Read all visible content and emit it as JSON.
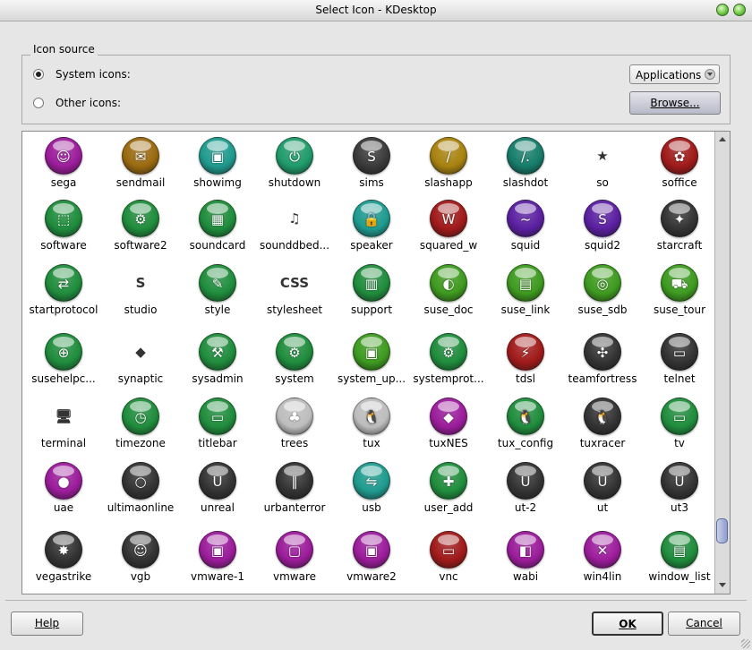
{
  "window": {
    "title": "Select Icon - KDesktop"
  },
  "icon_source": {
    "group_title": "Icon source",
    "system_icons_label": "System icons:",
    "other_icons_label": "Other icons:",
    "selected": "system",
    "category_select": "Applications",
    "browse_label": "Browse..."
  },
  "icons": [
    {
      "label": "sega",
      "color": "#9b1c9b",
      "glyph": "☺"
    },
    {
      "label": "sendmail",
      "color": "#9a6a10",
      "glyph": "✉"
    },
    {
      "label": "showimg",
      "color": "#1f9a8e",
      "glyph": "▣"
    },
    {
      "label": "shutdown",
      "color": "#1f9a6a",
      "glyph": "⏻"
    },
    {
      "label": "sims",
      "color": "#3a3a3a",
      "glyph": "S"
    },
    {
      "label": "slashapp",
      "color": "#a8820f",
      "glyph": "/"
    },
    {
      "label": "slashdot",
      "color": "#167c6a",
      "glyph": "/."
    },
    {
      "label": "so",
      "color": "none",
      "glyph": "★"
    },
    {
      "label": "soffice",
      "color": "#a01a1a",
      "glyph": "✿"
    },
    {
      "label": "software",
      "color": "#1f8c3c",
      "glyph": "⬚"
    },
    {
      "label": "software2",
      "color": "#1f8c3c",
      "glyph": "⚙"
    },
    {
      "label": "soundcard",
      "color": "#1f8c3c",
      "glyph": "▦"
    },
    {
      "label": "sounddbed...",
      "color": "none",
      "glyph": "♫"
    },
    {
      "label": "speaker",
      "color": "#1f9a8e",
      "glyph": "🔒"
    },
    {
      "label": "squared_w",
      "color": "#a01a1a",
      "glyph": "W"
    },
    {
      "label": "squid",
      "color": "#5a1fa0",
      "glyph": "~"
    },
    {
      "label": "squid2",
      "color": "#5a1fa0",
      "glyph": "S"
    },
    {
      "label": "starcraft",
      "color": "#333333",
      "glyph": "✦"
    },
    {
      "label": "startprotocol",
      "color": "#1f8c3c",
      "glyph": "⇄"
    },
    {
      "label": "studio",
      "color": "none",
      "glyph": "S"
    },
    {
      "label": "style",
      "color": "#1f8c3c",
      "glyph": "✎"
    },
    {
      "label": "stylesheet",
      "color": "none",
      "glyph": "CSS"
    },
    {
      "label": "support",
      "color": "#1f8c3c",
      "glyph": "▥"
    },
    {
      "label": "suse_doc",
      "color": "#3d9a1f",
      "glyph": "◐"
    },
    {
      "label": "suse_link",
      "color": "#3d9a1f",
      "glyph": "▤"
    },
    {
      "label": "suse_sdb",
      "color": "#3d9a1f",
      "glyph": "◎"
    },
    {
      "label": "suse_tour",
      "color": "#3d9a1f",
      "glyph": "⛟"
    },
    {
      "label": "susehelpc...",
      "color": "#1f8c3c",
      "glyph": "⊕"
    },
    {
      "label": "synaptic",
      "color": "none",
      "glyph": "◆"
    },
    {
      "label": "sysadmin",
      "color": "#1f8c3c",
      "glyph": "⚒"
    },
    {
      "label": "system",
      "color": "#1f8c3c",
      "glyph": "⚙"
    },
    {
      "label": "system_up...",
      "color": "#3d9a1f",
      "glyph": "▣"
    },
    {
      "label": "systemprot...",
      "color": "#1f8c3c",
      "glyph": "⚙"
    },
    {
      "label": "tdsl",
      "color": "#a01a1a",
      "glyph": "⚡"
    },
    {
      "label": "teamfortress",
      "color": "#333333",
      "glyph": "✣"
    },
    {
      "label": "telnet",
      "color": "#333333",
      "glyph": "▭"
    },
    {
      "label": "terminal",
      "color": "none",
      "glyph": "🖥"
    },
    {
      "label": "timezone",
      "color": "#1f8c3c",
      "glyph": "◷"
    },
    {
      "label": "titlebar",
      "color": "#1f8c3c",
      "glyph": "▭"
    },
    {
      "label": "trees",
      "color": "#bdbdbd",
      "glyph": "♣"
    },
    {
      "label": "tux",
      "color": "#bdbdbd",
      "glyph": "🐧"
    },
    {
      "label": "tuxNES",
      "color": "#9b1c9b",
      "glyph": "◆"
    },
    {
      "label": "tux_config",
      "color": "#1f8c3c",
      "glyph": "🐧"
    },
    {
      "label": "tuxracer",
      "color": "#333333",
      "glyph": "🐧"
    },
    {
      "label": "tv",
      "color": "#1f8c3c",
      "glyph": "▭"
    },
    {
      "label": "uae",
      "color": "#9b1c9b",
      "glyph": "●"
    },
    {
      "label": "ultimaonline",
      "color": "#333333",
      "glyph": "○"
    },
    {
      "label": "unreal",
      "color": "#333333",
      "glyph": "U"
    },
    {
      "label": "urbanterror",
      "color": "#333333",
      "glyph": "∥"
    },
    {
      "label": "usb",
      "color": "#1f9a8e",
      "glyph": "⇋"
    },
    {
      "label": "user_add",
      "color": "#1f8c3c",
      "glyph": "✚"
    },
    {
      "label": "ut-2",
      "color": "#333333",
      "glyph": "U"
    },
    {
      "label": "ut",
      "color": "#333333",
      "glyph": "U"
    },
    {
      "label": "ut3",
      "color": "#333333",
      "glyph": "U"
    },
    {
      "label": "vegastrike",
      "color": "#333333",
      "glyph": "✸"
    },
    {
      "label": "vgb",
      "color": "#333333",
      "glyph": "☺"
    },
    {
      "label": "vmware-1",
      "color": "#9b1c9b",
      "glyph": "▣"
    },
    {
      "label": "vmware",
      "color": "#9b1c9b",
      "glyph": "▢"
    },
    {
      "label": "vmware2",
      "color": "#9b1c9b",
      "glyph": "▣"
    },
    {
      "label": "vnc",
      "color": "#a01a1a",
      "glyph": "▭"
    },
    {
      "label": "wabi",
      "color": "#9b1c9b",
      "glyph": "◧"
    },
    {
      "label": "win4lin",
      "color": "#9b1c9b",
      "glyph": "✕"
    },
    {
      "label": "window_list",
      "color": "#1f8c3c",
      "glyph": "▤"
    }
  ],
  "buttons": {
    "help": "Help",
    "ok": "OK",
    "cancel": "Cancel"
  }
}
